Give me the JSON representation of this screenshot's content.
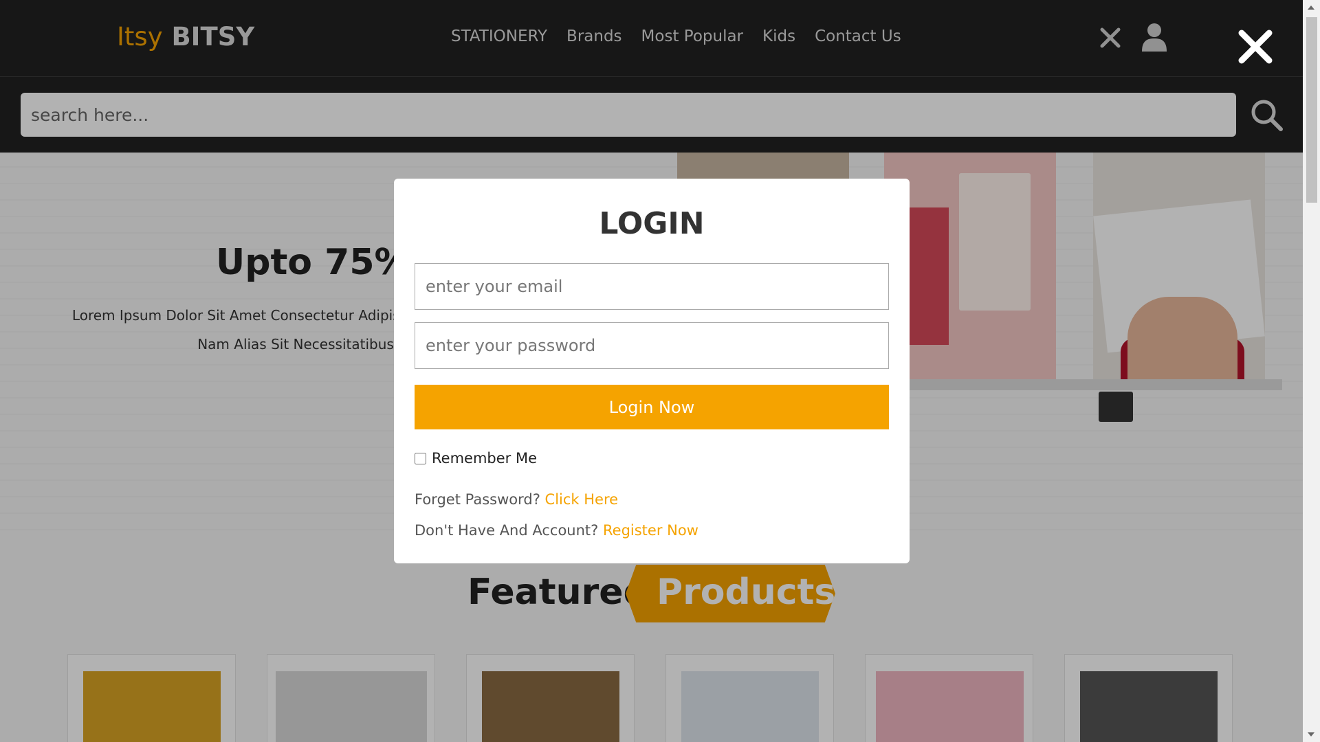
{
  "header": {
    "logo_part1": "Itsy",
    "logo_part2": "BITSY",
    "nav": [
      "STATIONERY",
      "Brands",
      "Most Popular",
      "Kids",
      "Contact Us"
    ],
    "icons": [
      "close-icon",
      "user-icon"
    ]
  },
  "search": {
    "placeholder": "search here...",
    "icon": "search-icon"
  },
  "hero": {
    "title": "Upto 75%",
    "text": "Lorem Ipsum Dolor Sit Amet Consectetur Adipisicing Accusamus. Nam Alias Sit Necessitatibus"
  },
  "featured": {
    "title_part1": "Featured",
    "title_part2": "Products"
  },
  "login": {
    "title": "LOGIN",
    "email_placeholder": "enter your email",
    "password_placeholder": "enter your password",
    "button": "Login Now",
    "remember": "Remember Me",
    "forget_text": "Forget Password?",
    "forget_link": "Click Here",
    "register_text": "Don't Have And Account?",
    "register_link": "Register Now"
  },
  "colors": {
    "accent": "#f5a300",
    "header_bg": "#222222"
  }
}
